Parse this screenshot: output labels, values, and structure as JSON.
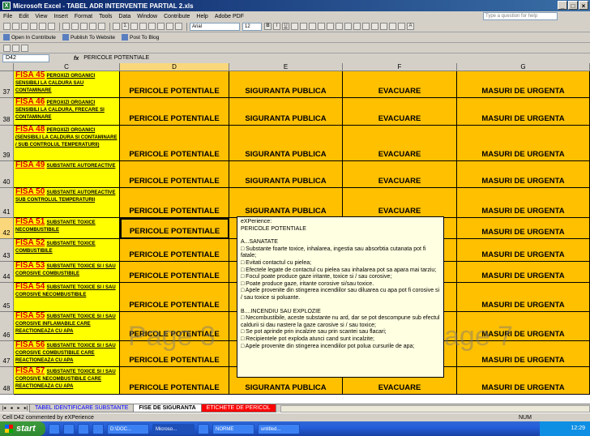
{
  "window": {
    "title": "Microsoft Excel - TABEL ADR INTERVENTIE PARTIAL 2.xls",
    "app_icon": "X"
  },
  "menu": {
    "items": [
      "File",
      "Edit",
      "View",
      "Insert",
      "Format",
      "Tools",
      "Data",
      "Window",
      "Contribute",
      "Help",
      "Adobe PDF"
    ],
    "question_placeholder": "Type a question for help"
  },
  "toolbar": {
    "font_name": "Arial",
    "font_size": "12",
    "contribute": {
      "open": "Open In Contribute",
      "publish": "Publish To Website",
      "post": "Post To Blog"
    }
  },
  "formula_bar": {
    "cell_ref": "D42",
    "fx": "fx",
    "content": "PERICOLE POTENTIALE"
  },
  "columns": [
    {
      "letter": "C",
      "active": false
    },
    {
      "letter": "D",
      "active": true
    },
    {
      "letter": "E",
      "active": false
    },
    {
      "letter": "F",
      "active": false
    },
    {
      "letter": "G",
      "active": false
    }
  ],
  "header_labels": {
    "d": "PERICOLE POTENTIALE",
    "e": "SIGURANTA PUBLICA",
    "f": "EVACUARE",
    "g": "MASURI DE  URGENTA"
  },
  "rows": [
    {
      "num": "37",
      "fisa": "FISA 45",
      "desc": "PEROXIZI ORGANICI SENSIBILI LA CALDURA SAU CONTAMINARE"
    },
    {
      "num": "38",
      "fisa": "FISA 46",
      "desc": "PEROXIZI ORGANICI SENSIBILI LA CALDURA, FRECARE SI CONTAMINARE"
    },
    {
      "num": "39",
      "fisa": "FISA 48",
      "desc": "PEROXIZI ORGANICI (SENSIBILI LA CALDURA SI CONTAMINARE / SUB CONTROLUL TEMPERATURII)"
    },
    {
      "num": "40",
      "fisa": "FISA 49",
      "desc": "SUBSTANTE AUTOREACTIVE"
    },
    {
      "num": "41",
      "fisa": "FISA 50",
      "desc": "SUBSTANTE AUTOREACTIVE SUB CONTROLUL TEMPERATURII"
    },
    {
      "num": "42",
      "fisa": "FISA 51",
      "desc": "SUBSTANTE TOXICE NECOMBUSTIBILE"
    },
    {
      "num": "43",
      "fisa": "FISA 52",
      "desc": "SUBSTANTE TOXICE COMBUSTIBILE"
    },
    {
      "num": "44",
      "fisa": "FISA 53",
      "desc": "SUBSTANTE TOXICE SI / SAU COROSIVE COMBUSTIBILE"
    },
    {
      "num": "45",
      "fisa": "FISA 54",
      "desc": "SUBSTANTE TOXICE SI / SAU COROSIVE NECOMBUSTIBILE"
    },
    {
      "num": "46",
      "fisa": "FISA 55",
      "desc": "SUBSTANTE TOXICE SI / SAU COROSIVE INFLAMABILE CARE REACTIONEAZA CU APA"
    },
    {
      "num": "47",
      "fisa": "FISA 56",
      "desc": "SUBSTANTE TOXICE SI / SAU COROSIVE COMBUSTIBILE CARE REACTIONEAZA CU APA"
    },
    {
      "num": "48",
      "fisa": "FISA 57",
      "desc": "SUBSTANTE TOXICE SI / SAU COROSIVE NECOMBUSTIBILE CARE REACTIONEAZA CU APA"
    }
  ],
  "watermarks": {
    "left": "Page 3",
    "right": "age 7"
  },
  "comment": {
    "author": "eXPerience:",
    "lines": [
      "PERICOLE  POTENTIALE",
      "",
      "A...SANATATE",
      "□ Substante foarte toxice,  inhalarea, ingestia sau absorbtia cutanata pot fi fatale;",
      "□ Evitati contactul cu pielea;",
      "□ Efectele legate de contactul cu pielea sau inhalarea pot sa apara mai tarziu;",
      "□ Focul poate produce gaze iritante, toxice si / sau corosive;",
      "□ Poate produce gaze, iritante corosive si/sau toxice.",
      "□ Apele provenite din stingerea incendiilor sau diluarea cu apa pot fi corosive si / sau toxice si poluante.",
      "",
      "B....INCENDIU SAU EXPLOZIE",
      "□ Necombustibile, aceste substante nu ard, dar se pot descompune sub efectul caldurii si dau nastere la gaze carosive si / sau toxice;",
      "□ Se pot aprinde prin incalzire sau prin scantei sau flacari;",
      "□ Recipientele pot exploda atunci cand sunt incalzite;",
      "□ Apele provenite din stingerea incendiilor pot polua cursurile de apa;"
    ]
  },
  "sheet_tabs": [
    "TABEL IDENTIFICARE SUBSTANTE",
    "FISE DE SIGURANTA",
    "ETICHETE DE PERICOL"
  ],
  "status": {
    "left": "Cell D42 commented by eXPerience",
    "num": "NUM"
  },
  "taskbar": {
    "start": "start",
    "tasks": [
      "",
      "",
      "",
      "",
      "D:\\DOC...",
      "Microso...",
      "",
      "NORME",
      "untitled..."
    ],
    "clock": "12:29"
  }
}
